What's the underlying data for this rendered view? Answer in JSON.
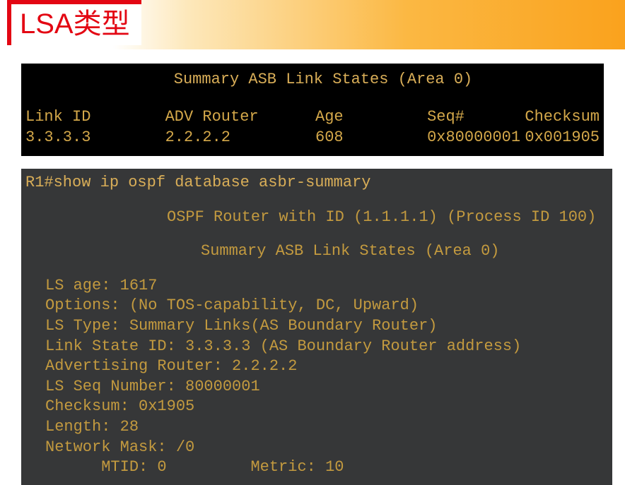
{
  "title": "LSA类型",
  "terminal1": {
    "header": "Summary ASB Link States (Area 0)",
    "columns": {
      "linkid": "Link ID",
      "adv": "ADV Router",
      "age": "Age",
      "seq": "Seq#",
      "chk": "Checksum"
    },
    "row": {
      "linkid": "3.3.3.3",
      "adv": "2.2.2.2",
      "age": "608",
      "seq": "0x80000001",
      "chk": "0x001905"
    }
  },
  "terminal2": {
    "command": "R1#show ip ospf database asbr-summary",
    "header1": "OSPF Router with ID (1.1.1.1) (Process ID 100)",
    "header2": "Summary ASB Link States (Area 0)",
    "lines": {
      "lsage": "LS age: 1617",
      "options": "Options: (No TOS-capability, DC, Upward)",
      "lstype": "LS Type: Summary Links(AS Boundary Router)",
      "linkstateid": "Link State ID: 3.3.3.3 (AS Boundary Router address)",
      "advr": "Advertising Router: 2.2.2.2",
      "lsseq": "LS Seq Number: 80000001",
      "checksum": "Checksum: 0x1905",
      "length": "Length: 28",
      "netmask": "Network Mask: /0",
      "mtid": "      MTID: 0         Metric: 10"
    }
  }
}
